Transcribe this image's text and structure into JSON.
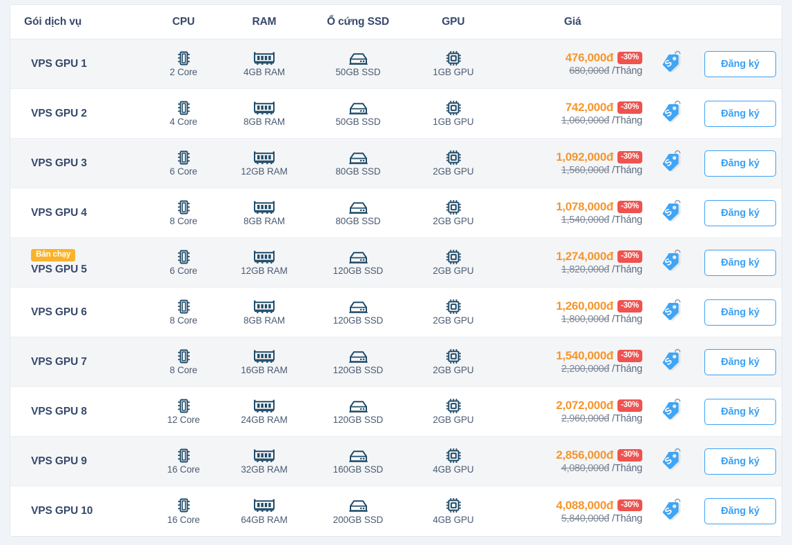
{
  "table": {
    "headers": {
      "package": "Gói dịch vụ",
      "cpu": "CPU",
      "ram": "RAM",
      "ssd": "Ổ cứng SSD",
      "gpu": "GPU",
      "price": "Giá",
      "tag": "",
      "action": ""
    },
    "labels": {
      "hot_badge": "Bán chạy",
      "register_button": "Đăng ký",
      "period": "/Tháng"
    },
    "colors": {
      "accent_blue": "#39a0f5",
      "price_orange": "#f5962d",
      "discount_red": "#ef5350",
      "hot_badge_amber": "#f9b22a",
      "heading_navy": "#36486b",
      "icon_navy": "#1f4b68",
      "row_alt_bg": "#f4f5f7",
      "page_bg": "#f0f4f8"
    },
    "rows": [
      {
        "name": "VPS GPU 1",
        "badge": "",
        "cpu": "2 Core",
        "ram": "4GB RAM",
        "ssd": "50GB SSD",
        "gpu": "1GB GPU",
        "price_new": "476,000đ",
        "discount": "-30%",
        "price_old": "680,000đ",
        "period": "/Tháng",
        "action": "Đăng ký"
      },
      {
        "name": "VPS GPU 2",
        "badge": "",
        "cpu": "4 Core",
        "ram": "8GB RAM",
        "ssd": "50GB SSD",
        "gpu": "1GB GPU",
        "price_new": "742,000đ",
        "discount": "-30%",
        "price_old": "1,060,000đ",
        "period": "/Tháng",
        "action": "Đăng ký"
      },
      {
        "name": "VPS GPU 3",
        "badge": "",
        "cpu": "6 Core",
        "ram": "12GB RAM",
        "ssd": "80GB SSD",
        "gpu": "2GB GPU",
        "price_new": "1,092,000đ",
        "discount": "-30%",
        "price_old": "1,560,000đ",
        "period": "/Tháng",
        "action": "Đăng ký"
      },
      {
        "name": "VPS GPU 4",
        "badge": "",
        "cpu": "8 Core",
        "ram": "8GB RAM",
        "ssd": "80GB SSD",
        "gpu": "2GB GPU",
        "price_new": "1,078,000đ",
        "discount": "-30%",
        "price_old": "1,540,000đ",
        "period": "/Tháng",
        "action": "Đăng ký"
      },
      {
        "name": "VPS GPU 5",
        "badge": "Bán chạy",
        "cpu": "6 Core",
        "ram": "12GB RAM",
        "ssd": "120GB SSD",
        "gpu": "2GB GPU",
        "price_new": "1,274,000đ",
        "discount": "-30%",
        "price_old": "1,820,000đ",
        "period": "/Tháng",
        "action": "Đăng ký"
      },
      {
        "name": "VPS GPU 6",
        "badge": "",
        "cpu": "8 Core",
        "ram": "8GB RAM",
        "ssd": "120GB SSD",
        "gpu": "2GB GPU",
        "price_new": "1,260,000đ",
        "discount": "-30%",
        "price_old": "1,800,000đ",
        "period": "/Tháng",
        "action": "Đăng ký"
      },
      {
        "name": "VPS GPU 7",
        "badge": "",
        "cpu": "8 Core",
        "ram": "16GB RAM",
        "ssd": "120GB SSD",
        "gpu": "2GB GPU",
        "price_new": "1,540,000đ",
        "discount": "-30%",
        "price_old": "2,200,000đ",
        "period": "/Tháng",
        "action": "Đăng ký"
      },
      {
        "name": "VPS GPU 8",
        "badge": "",
        "cpu": "12 Core",
        "ram": "24GB RAM",
        "ssd": "120GB SSD",
        "gpu": "2GB GPU",
        "price_new": "2,072,000đ",
        "discount": "-30%",
        "price_old": "2,960,000đ",
        "period": "/Tháng",
        "action": "Đăng ký"
      },
      {
        "name": "VPS GPU 9",
        "badge": "",
        "cpu": "16 Core",
        "ram": "32GB RAM",
        "ssd": "160GB SSD",
        "gpu": "4GB GPU",
        "price_new": "2,856,000đ",
        "discount": "-30%",
        "price_old": "4,080,000đ",
        "period": "/Tháng",
        "action": "Đăng ký"
      },
      {
        "name": "VPS GPU 10",
        "badge": "",
        "cpu": "16 Core",
        "ram": "64GB RAM",
        "ssd": "200GB SSD",
        "gpu": "4GB GPU",
        "price_new": "4,088,000đ",
        "discount": "-30%",
        "price_old": "5,840,000đ",
        "period": "/Tháng",
        "action": "Đăng ký"
      }
    ],
    "icons": {
      "cpu": "cpu-chip-icon",
      "ram": "memory-stick-icon",
      "ssd": "hard-drive-icon",
      "gpu": "gpu-chip-icon",
      "sale": "sale-tag-icon"
    }
  }
}
